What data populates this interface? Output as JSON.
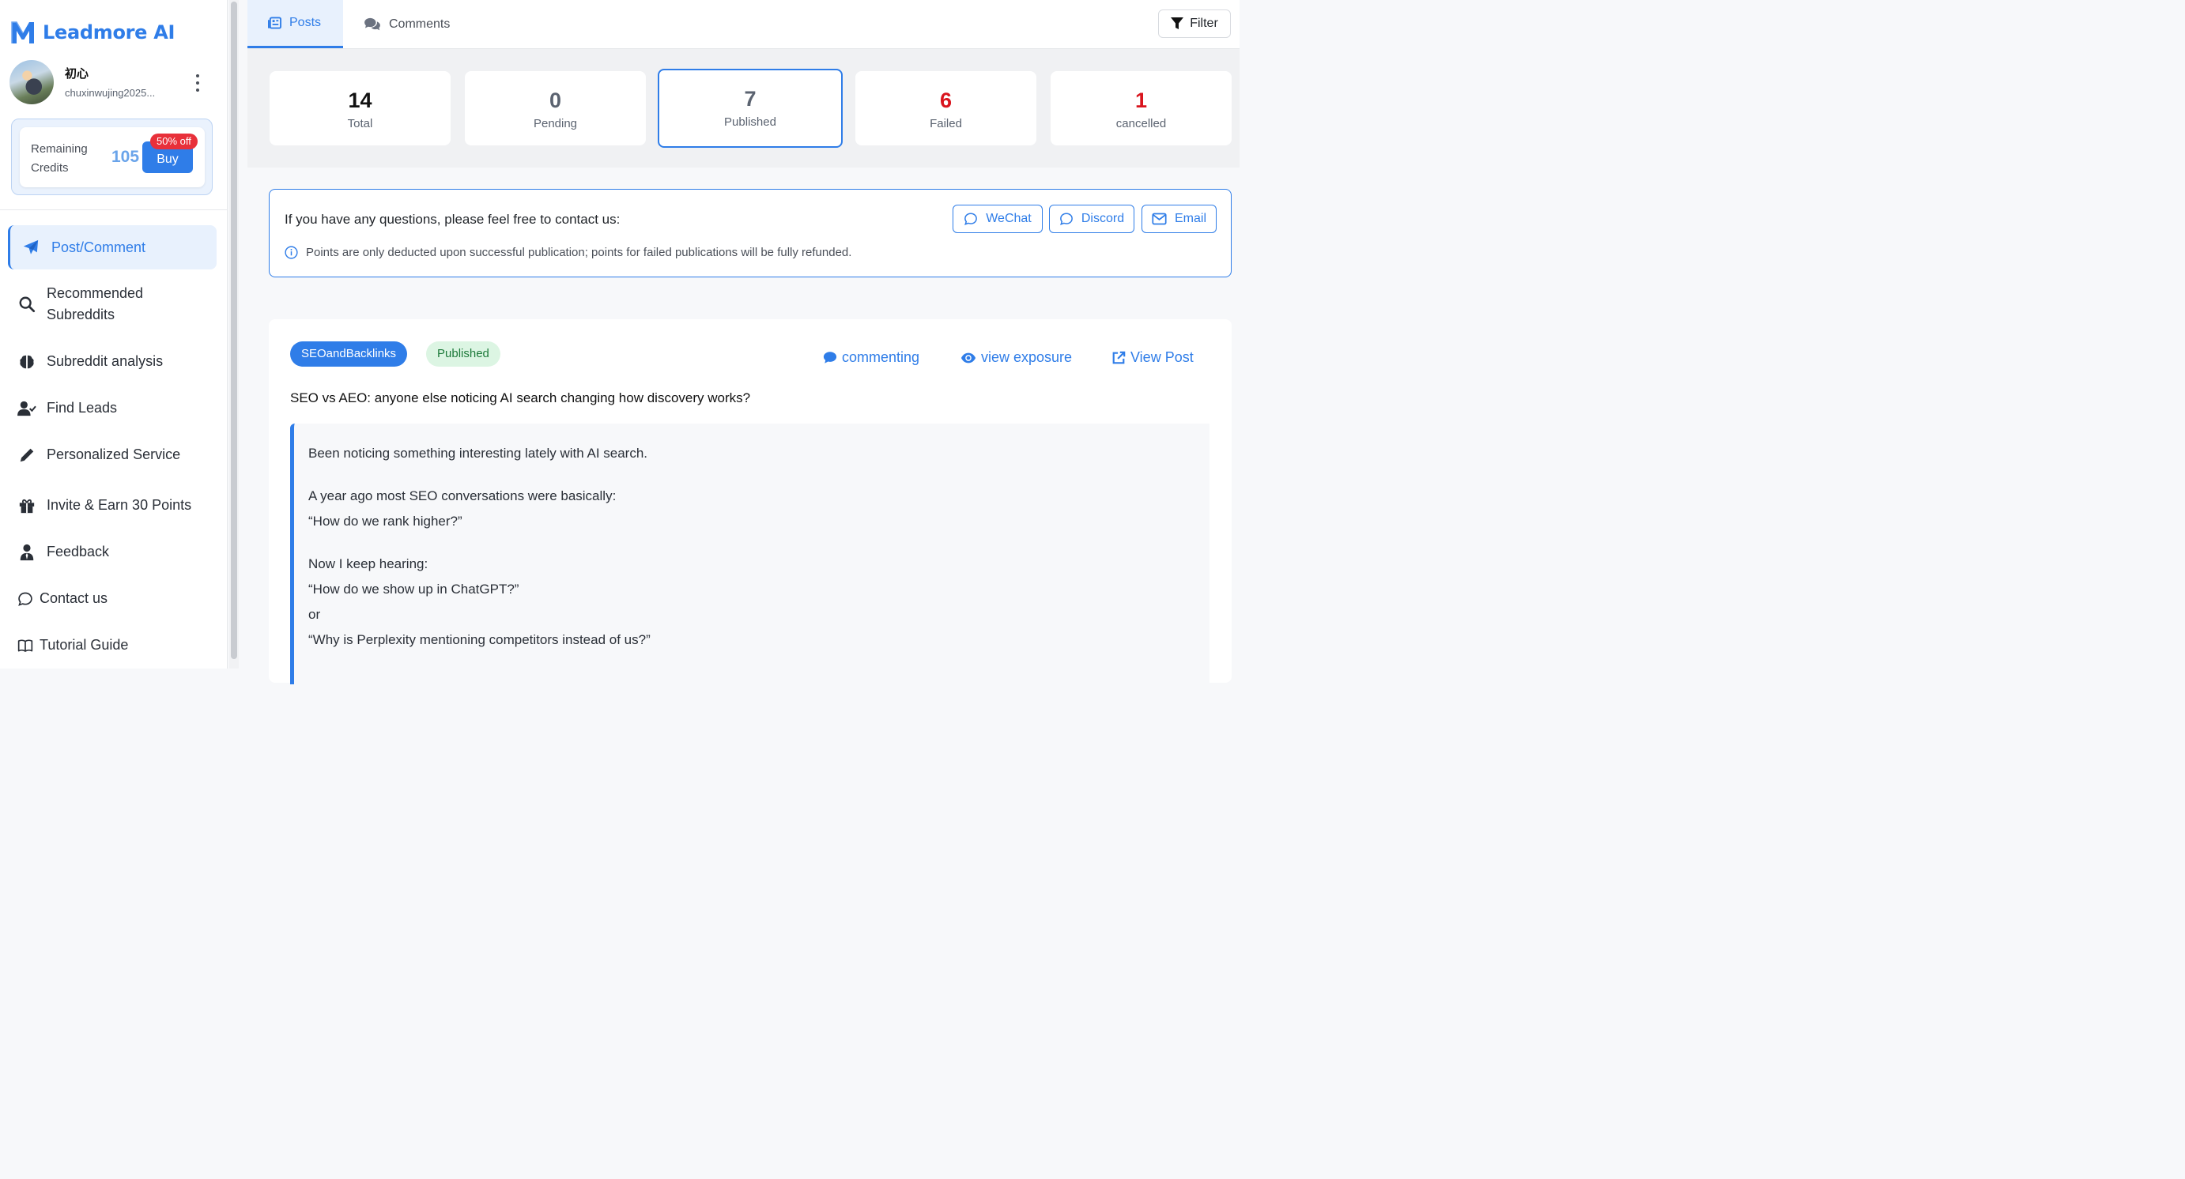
{
  "brand": {
    "name": "Leadmore AI",
    "logo_letter": "M",
    "color": "#2f7de8"
  },
  "user": {
    "name": "初心",
    "email": "chuxinwujing2025..."
  },
  "credits": {
    "label": "Remaining Credits",
    "value": "105",
    "buy_label": "Buy",
    "discount": "50% off"
  },
  "sidebar": {
    "items": [
      {
        "label": "Post/Comment",
        "icon": "paper-plane-icon",
        "active": true
      },
      {
        "label": "Recommended Subreddits",
        "icon": "search-icon"
      },
      {
        "label": "Subreddit analysis",
        "icon": "brain-icon"
      },
      {
        "label": "Find Leads",
        "icon": "user-check-icon"
      },
      {
        "label": "Personalized Service",
        "icon": "pencil-icon"
      },
      {
        "label": "Invite & Earn 30 Points",
        "icon": "gift-icon"
      },
      {
        "label": "Feedback",
        "icon": "user-tie-icon"
      },
      {
        "label": "Contact us",
        "icon": "chat-bubble-icon"
      },
      {
        "label": "Tutorial Guide",
        "icon": "book-icon"
      }
    ]
  },
  "tabs": [
    {
      "label": "Posts",
      "icon": "list-icon",
      "active": true
    },
    {
      "label": "Comments",
      "icon": "comments-icon"
    }
  ],
  "filter_label": "Filter",
  "stats": [
    {
      "value": "14",
      "label": "Total",
      "color": "#111111"
    },
    {
      "value": "0",
      "label": "Pending",
      "color": "#5b6370"
    },
    {
      "value": "7",
      "label": "Published",
      "color": "#5b6370",
      "selected": true
    },
    {
      "value": "6",
      "label": "Failed",
      "color": "#d9151e"
    },
    {
      "value": "1",
      "label": "cancelled",
      "color": "#d9151e"
    }
  ],
  "contact": {
    "title": "If you have any questions, please feel free to contact us:",
    "note": "Points are only deducted upon successful publication; points for failed publications will be fully refunded.",
    "buttons": [
      "WeChat",
      "Discord",
      "Email"
    ]
  },
  "post": {
    "subreddit": "SEOandBacklinks",
    "status": "Published",
    "actions": [
      "commenting",
      "view exposure",
      "View Post"
    ],
    "title": "SEO vs AEO: anyone else noticing AI search changing how discovery works?",
    "body": [
      [
        "Been noticing something interesting lately with AI search."
      ],
      [
        "A year ago most SEO conversations were basically:",
        "“How do we rank higher?”"
      ],
      [
        "Now I keep hearing:",
        "“How do we show up in ChatGPT?”",
        "or",
        "“Why is Perplexity mentioning competitors instead of us?”"
      ]
    ]
  }
}
